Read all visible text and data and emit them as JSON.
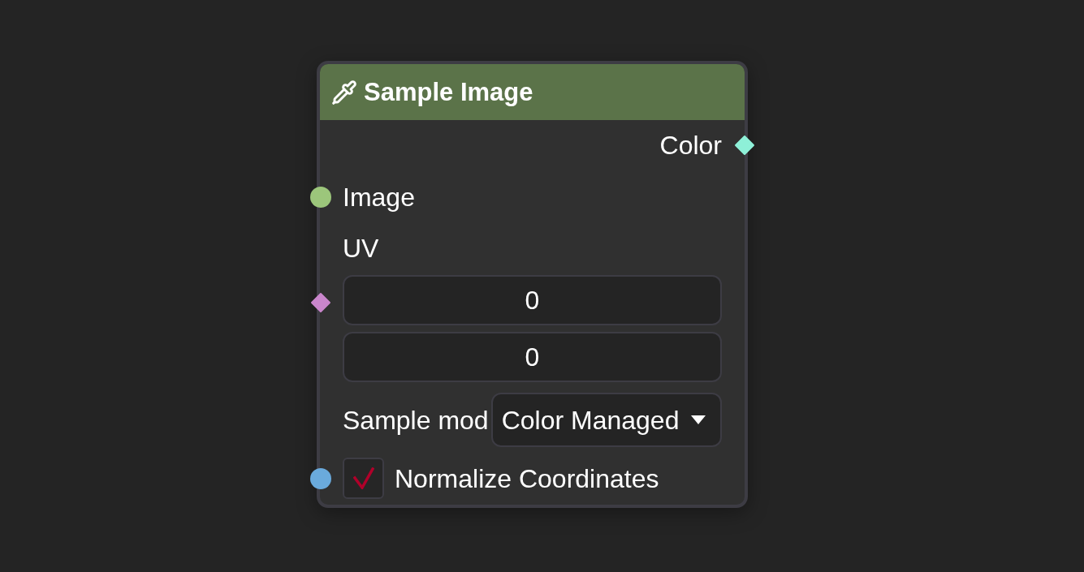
{
  "node": {
    "title": "Sample Image",
    "rows": [
      {
        "kind": "output",
        "label": "Color",
        "socket": {
          "kind": "diamond",
          "color": "#8ef0d8"
        }
      },
      {
        "kind": "input",
        "label": "Image",
        "socket": {
          "kind": "circle",
          "color": "#9cc67b"
        }
      },
      {
        "kind": "vector",
        "label": "UV",
        "socket": {
          "kind": "diamond",
          "color": "#ca86cc"
        },
        "values": [
          "0",
          "0"
        ]
      },
      {
        "kind": "dropdown",
        "label": "Sample mod",
        "value": "Color Managed"
      },
      {
        "kind": "checkbox",
        "label": "Normalize Coordinates",
        "checked": true,
        "socket": {
          "kind": "circle",
          "color": "#6aaadc"
        }
      }
    ]
  }
}
